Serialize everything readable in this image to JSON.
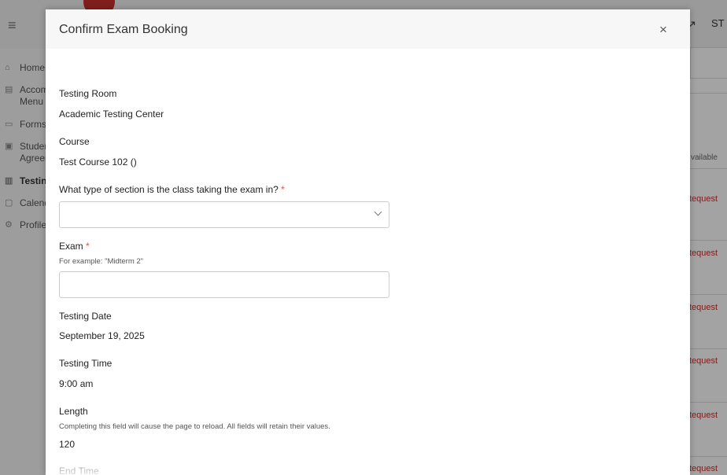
{
  "background": {
    "user_initials": "ST",
    "nav": [
      {
        "label": "Home",
        "icon": "home-icon"
      },
      {
        "label": "Accom Menu",
        "icon": "list-icon"
      },
      {
        "label": "Forms",
        "icon": "folder-icon"
      },
      {
        "label": "Studen Agreer",
        "icon": "document-icon"
      },
      {
        "label": "Testin",
        "icon": "clipboard-icon"
      },
      {
        "label": "Calend",
        "icon": "calendar-icon"
      },
      {
        "label": "Profile",
        "icon": "gear-icon"
      }
    ],
    "table_header": "vailable",
    "request_label": "Request",
    "request_labels_visible": [
      "tequest",
      "tequest",
      "tequest",
      "tequest",
      "tequest",
      "tequest"
    ]
  },
  "modal": {
    "title": "Confirm Exam Booking",
    "close_glyph": "×",
    "testing_room_label": "Testing Room",
    "testing_room_value": "Academic Testing Center",
    "course_label": "Course",
    "course_value": "Test Course 102 ()",
    "section_type_label": "What type of section is the class taking the exam in?",
    "section_type_value": "",
    "required_marker": "*",
    "exam_label": "Exam",
    "exam_hint": "For example: \"Midterm 2\"",
    "exam_value": "",
    "testing_date_label": "Testing Date",
    "testing_date_value": "September 19, 2025",
    "testing_time_label": "Testing Time",
    "testing_time_value": "9:00 am",
    "length_label": "Length",
    "length_hint": "Completing this field will cause the page to reload. All fields will retain their values.",
    "length_value": "120",
    "end_time_label": "End Time"
  },
  "colors": {
    "accent_red": "#c9302c",
    "required_red": "#d9534f"
  }
}
